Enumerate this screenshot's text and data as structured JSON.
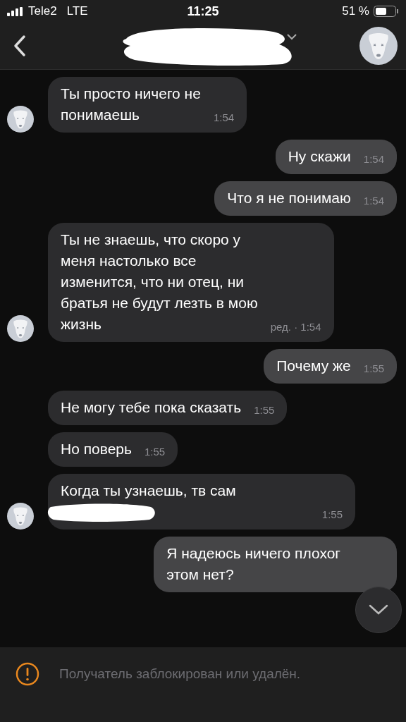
{
  "status_bar": {
    "carrier": "Tele2",
    "network": "LTE",
    "time": "11:25",
    "battery": "51 %"
  },
  "header": {
    "title_redacted": true
  },
  "messages": [
    {
      "kind": "incoming",
      "text": "Ты просто ничего не\nпонимаешь",
      "time": "1:54",
      "avatar": true
    },
    {
      "kind": "outgoing",
      "text": "Ну скажи",
      "time": "1:54"
    },
    {
      "kind": "outgoing",
      "text": "Что я не понимаю",
      "time": "1:54"
    },
    {
      "kind": "incoming",
      "text": "Ты не знаешь, что скоро у\nменя настолько все\nизменится, что ни отец, ни\nбратья не будут лезть в мою\nжизнь",
      "time": "ред. · 1:54",
      "avatar": true
    },
    {
      "kind": "outgoing",
      "text": "Почему же",
      "time": "1:55"
    },
    {
      "kind": "incoming",
      "text": "Не могу тебе пока сказать",
      "time": "1:55",
      "avatar": false
    },
    {
      "kind": "incoming",
      "text": "Но поверь",
      "time": "1:55",
      "avatar": false
    },
    {
      "kind": "incoming",
      "text": "Когда ты узнаешь, тв сам",
      "time": "1:55",
      "avatar": true,
      "redacted": true
    },
    {
      "kind": "outgoing",
      "text": "Я надеюсь ничего плохог\nэтом нет?"
    }
  ],
  "notice": "Получатель заблокирован или удалён."
}
